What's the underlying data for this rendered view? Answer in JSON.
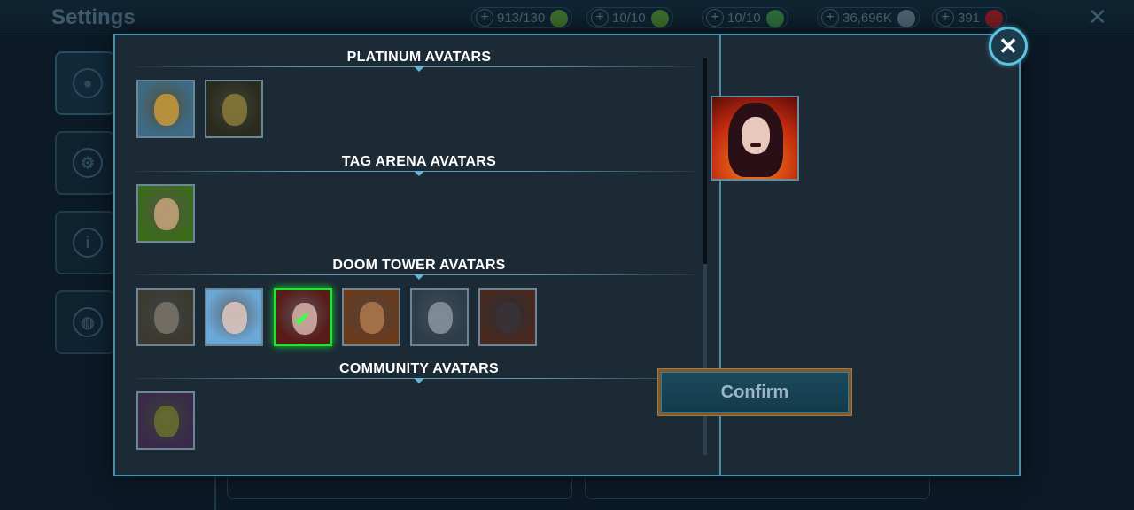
{
  "background": {
    "title": "Settings",
    "resources": [
      {
        "value": "913/130",
        "icon": "energy-icon",
        "color": "#3a6b2e"
      },
      {
        "value": "10/10",
        "icon": "green-gem-icon",
        "color": "#3a6b2e"
      },
      {
        "value": "10/10",
        "icon": "green-gem-icon",
        "color": "#2d6a3a"
      },
      {
        "value": "36,696K",
        "icon": "silver-coin-icon",
        "color": "#4a6070"
      },
      {
        "value": "391",
        "icon": "ruby-icon",
        "color": "#7a1a22"
      }
    ],
    "side_tabs": [
      "profile-icon",
      "gear-icon",
      "info-icon",
      "globe-icon"
    ]
  },
  "sections": [
    {
      "title": "PLATINUM AVATARS",
      "avatars": [
        {
          "name": "avatar-platinum-1",
          "bg": "#3d6a84",
          "face": "#c99a3a"
        },
        {
          "name": "avatar-platinum-2",
          "bg": "#2a2a1e",
          "face": "#8a7a3a"
        }
      ]
    },
    {
      "title": "TAG ARENA AVATARS",
      "avatars": [
        {
          "name": "avatar-tag-arena-1",
          "bg": "#3a6a1a",
          "face": "#c7a47a"
        }
      ]
    },
    {
      "title": "DOOM TOWER AVATARS",
      "avatars": [
        {
          "name": "avatar-doom-1",
          "bg": "#3c3a30",
          "face": "#7a7468"
        },
        {
          "name": "avatar-doom-2",
          "bg": "#6aa8d8",
          "face": "#e2c8c0"
        },
        {
          "name": "avatar-doom-3",
          "bg": "#5a1a18",
          "face": "#d8b0a8",
          "selected": true
        },
        {
          "name": "avatar-doom-4",
          "bg": "#6a3a1c",
          "face": "#b0784a"
        },
        {
          "name": "avatar-doom-5",
          "bg": "#2e3d4a",
          "face": "#8a96a0"
        },
        {
          "name": "avatar-doom-6",
          "bg": "#4a2a20",
          "face": "#3a3236"
        }
      ]
    },
    {
      "title": "COMMUNITY AVATARS",
      "avatars": [
        {
          "name": "avatar-community-1",
          "bg": "#3a2a4a",
          "face": "#6a7030"
        }
      ]
    }
  ],
  "confirm_label": "Confirm",
  "close_symbol": "✕",
  "accent_color": "#4b8ea8",
  "selected_color": "#27e03a"
}
